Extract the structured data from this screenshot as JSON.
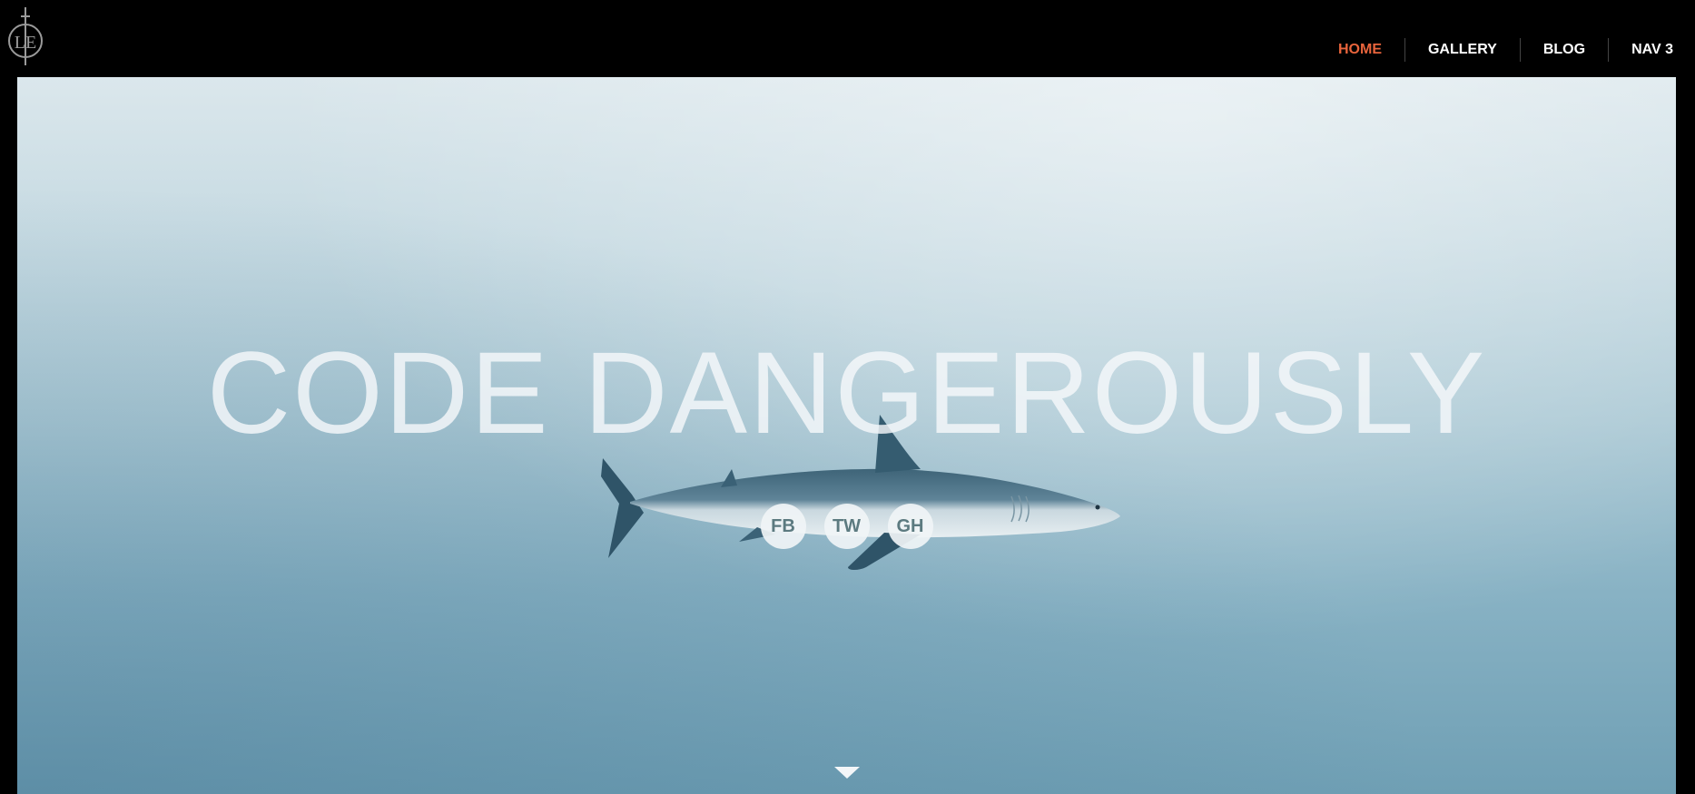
{
  "header": {
    "logo_icon": "le-monogram-logo-icon",
    "nav": [
      {
        "label": "HOME",
        "active": true
      },
      {
        "label": "GALLERY",
        "active": false
      },
      {
        "label": "BLOG",
        "active": false
      },
      {
        "label": "NAV 3",
        "active": false
      }
    ],
    "active_color": "#e8643c"
  },
  "hero": {
    "headline": "CODE DANGEROUSLY",
    "background_image": "shark-underwater",
    "social": [
      {
        "label": "FB"
      },
      {
        "label": "TW"
      },
      {
        "label": "GH"
      }
    ],
    "scroll_icon": "chevron-down-icon"
  }
}
